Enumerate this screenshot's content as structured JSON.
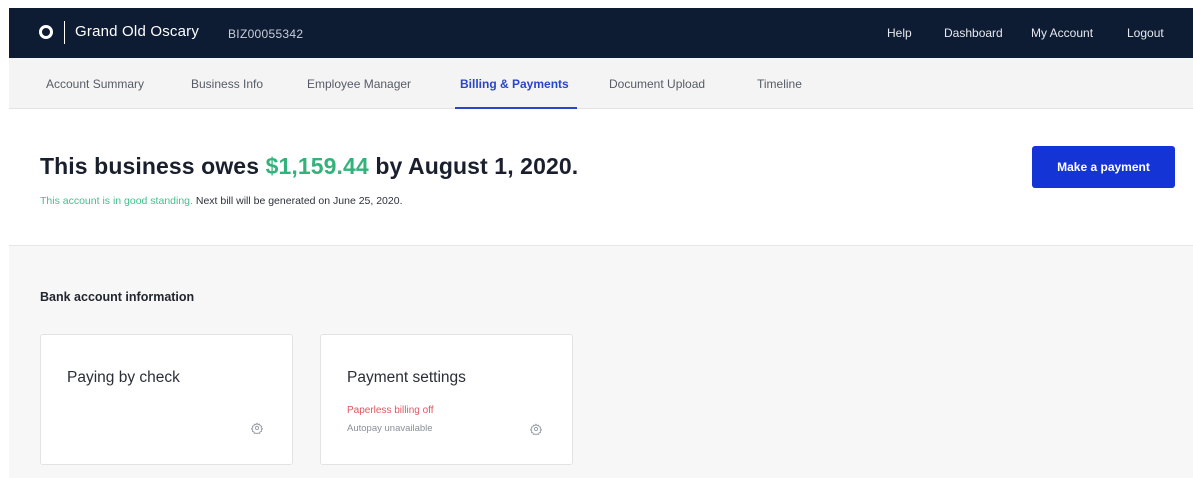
{
  "header": {
    "business_name": "Grand Old Oscary",
    "business_id": "BIZ00055342",
    "links": {
      "help": "Help",
      "dashboard": "Dashboard",
      "my_account": "My Account",
      "logout": "Logout"
    }
  },
  "tabs": [
    {
      "label": "Account Summary",
      "active": false
    },
    {
      "label": "Business Info",
      "active": false
    },
    {
      "label": "Employee Manager",
      "active": false
    },
    {
      "label": "Billing & Payments",
      "active": true
    },
    {
      "label": "Document Upload",
      "active": false
    },
    {
      "label": "Timeline",
      "active": false
    }
  ],
  "summary": {
    "headline_prefix": "This business owes",
    "amount": "$1,159.44",
    "headline_suffix": "by August 1, 2020.",
    "standing": "This account is in good standing.",
    "next_bill": "Next bill will be generated on June 25, 2020.",
    "pay_button": "Make a payment"
  },
  "bank_section": {
    "title": "Bank account information",
    "cards": [
      {
        "title": "Paying by check",
        "icon": "gear-icon"
      },
      {
        "title": "Payment settings",
        "status_off": "Paperless billing off",
        "status_muted": "Autopay unavailable",
        "icon": "gear-icon"
      }
    ]
  },
  "colors": {
    "nav_bg": "#0d1b33",
    "accent_blue": "#1534d6",
    "active_tab": "#2a45c8",
    "amount_green": "#34b27b",
    "standing_green": "#3fc18d",
    "alert_red": "#e0575e"
  }
}
